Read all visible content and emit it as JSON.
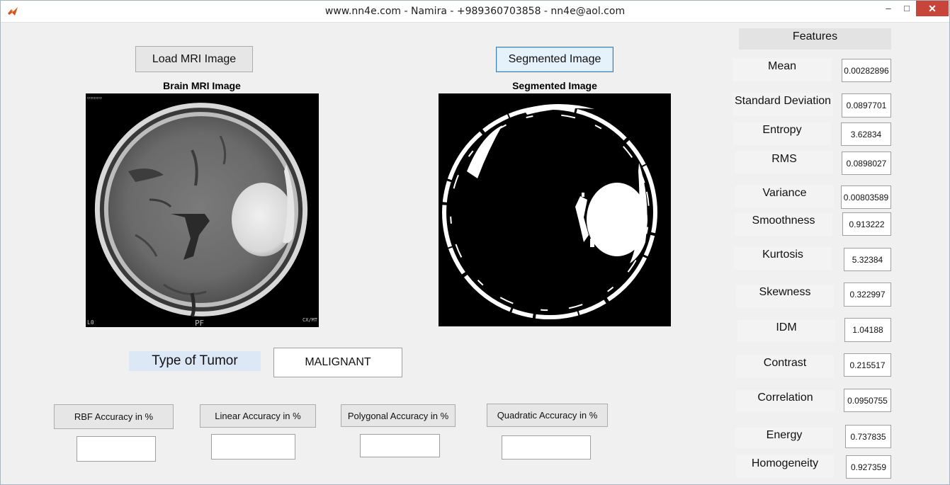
{
  "window": {
    "title": "www.nn4e.com - Namira - +989360703858 - nn4e@aol.com",
    "min_glyph": "–",
    "max_glyph": "□",
    "close_glyph": "✕"
  },
  "buttons": {
    "load": "Load MRI Image",
    "segment": "Segmented Image"
  },
  "captions": {
    "original": "Brain MRI Image",
    "segmented": "Segmented Image"
  },
  "tumor": {
    "label": "Type of Tumor",
    "value": "MALIGNANT"
  },
  "accuracy": {
    "rbf": "RBF Accuracy in %",
    "linear": "Linear Accuracy in %",
    "polygonal": "Polygonal Accuracy in %",
    "quadratic": "Quadratic Accuracy in %",
    "rbf_value": "",
    "linear_value": "",
    "polygonal_value": "",
    "quadratic_value": ""
  },
  "features": {
    "header": "Features",
    "items": [
      {
        "label": "Mean",
        "value": "0.00282896"
      },
      {
        "label": "Standard Deviation",
        "value": "0.0897701"
      },
      {
        "label": "Entropy",
        "value": "3.62834"
      },
      {
        "label": "RMS",
        "value": "0.0898027"
      },
      {
        "label": "Variance",
        "value": "0.00803589"
      },
      {
        "label": "Smoothness",
        "value": "0.913222"
      },
      {
        "label": "Kurtosis",
        "value": "5.32384"
      },
      {
        "label": "Skewness",
        "value": "0.322997"
      },
      {
        "label": "IDM",
        "value": "1.04188"
      },
      {
        "label": "Contrast",
        "value": "0.215517"
      },
      {
        "label": "Correlation",
        "value": "0.0950755"
      },
      {
        "label": "Energy",
        "value": "0.737835"
      },
      {
        "label": "Homogeneity",
        "value": "0.927359"
      }
    ]
  },
  "mri_overlay": {
    "top_left": "▫▫▫▫▫",
    "bottom_left": "L0",
    "bottom_center": "PF",
    "bottom_right": "CX/MT"
  }
}
